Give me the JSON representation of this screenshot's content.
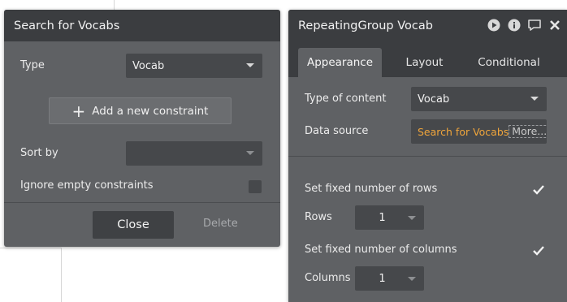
{
  "left_panel": {
    "title": "Search for Vocabs",
    "type_label": "Type",
    "type_value": "Vocab",
    "add_constraint_label": "Add a new constraint",
    "sort_by_label": "Sort by",
    "sort_by_value": "",
    "ignore_empty_label": "Ignore empty constraints",
    "ignore_empty_checked": false,
    "close_label": "Close",
    "delete_label": "Delete"
  },
  "right_panel": {
    "title": "RepeatingGroup Vocab",
    "header_icons": [
      "play-icon",
      "info-icon",
      "comment-icon",
      "close-icon"
    ],
    "tabs": [
      {
        "label": "Appearance",
        "active": true
      },
      {
        "label": "Layout",
        "active": false
      },
      {
        "label": "Conditional",
        "active": false
      }
    ],
    "type_of_content_label": "Type of content",
    "type_of_content_value": "Vocab",
    "data_source_label": "Data source",
    "data_source_value": "Search for Vocabs",
    "data_source_more": "More...",
    "fixed_rows_label": "Set fixed number of rows",
    "fixed_rows_checked": true,
    "rows_label": "Rows",
    "rows_value": "1",
    "fixed_columns_label": "Set fixed number of columns",
    "fixed_columns_checked": true,
    "columns_label": "Columns",
    "columns_value": "1"
  },
  "colors": {
    "panel_bg": "#5f6164",
    "header_bg": "#3b3d40",
    "field_bg": "#46484b",
    "accent_orange": "#f0a53b"
  }
}
